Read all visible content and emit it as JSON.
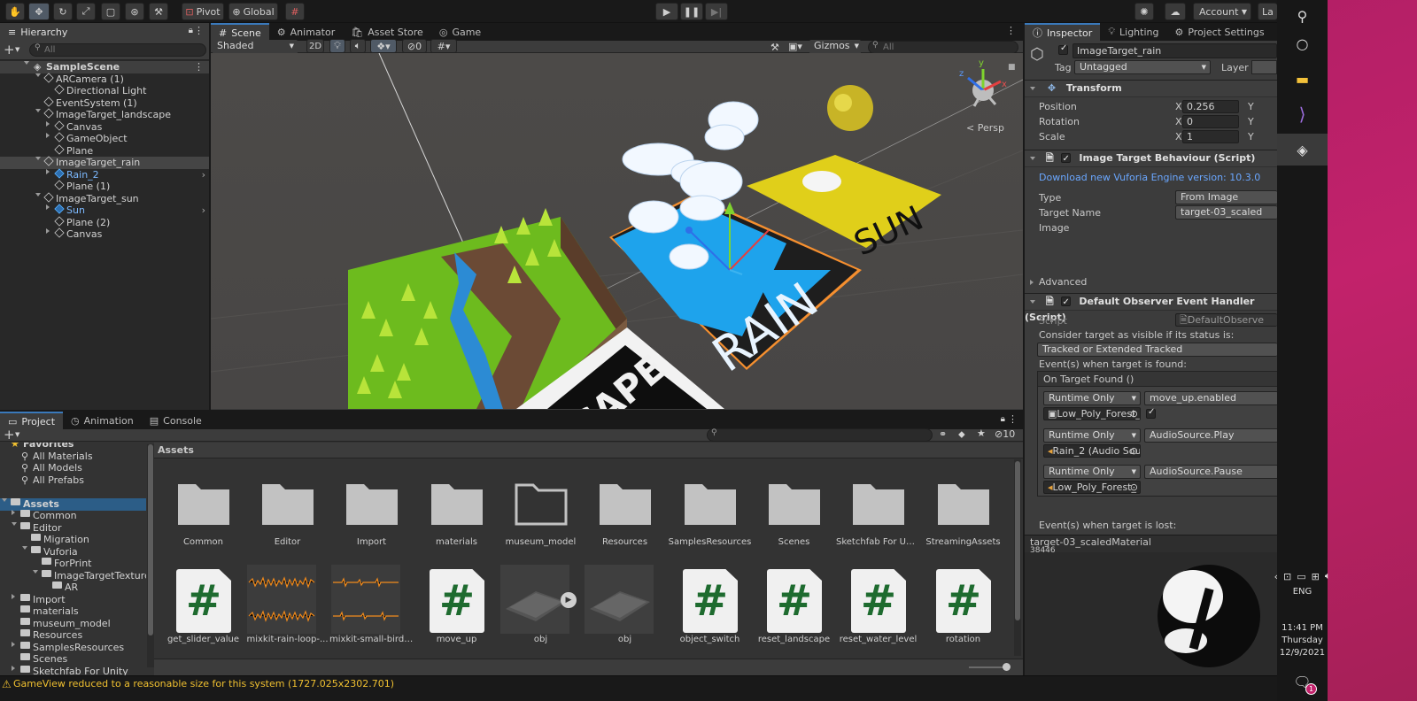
{
  "toolbar": {
    "pivot_label": "Pivot",
    "global_label": "Global",
    "account_label": "Account",
    "layers_label": "La"
  },
  "hierarchy": {
    "tab": "Hierarchy",
    "search_placeholder": "All",
    "items": [
      {
        "label": "SampleScene",
        "indent": 0
      },
      {
        "label": "ARCamera (1)",
        "indent": 1
      },
      {
        "label": "Directional Light",
        "indent": 2
      },
      {
        "label": "EventSystem (1)",
        "indent": 1
      },
      {
        "label": "ImageTarget_landscape",
        "indent": 1
      },
      {
        "label": "Canvas",
        "indent": 2
      },
      {
        "label": "GameObject",
        "indent": 2
      },
      {
        "label": "Plane",
        "indent": 2
      },
      {
        "label": "ImageTarget_rain",
        "indent": 1
      },
      {
        "label": "Rain_2",
        "indent": 2
      },
      {
        "label": "Plane (1)",
        "indent": 2
      },
      {
        "label": "ImageTarget_sun",
        "indent": 1
      },
      {
        "label": "Sun",
        "indent": 2
      },
      {
        "label": "Plane (2)",
        "indent": 2
      },
      {
        "label": "Canvas",
        "indent": 2
      }
    ]
  },
  "scene": {
    "tabs": [
      "Scene",
      "Animator",
      "Asset Store",
      "Game"
    ],
    "shading": "Shaded",
    "mode_2d": "2D",
    "hidden_count": "0",
    "gizmos": "Gizmos",
    "search_placeholder": "All",
    "persp_label": "< Persp",
    "card_rain": "RAIN",
    "card_sun": "SUN",
    "card_scape": "CAPE",
    "axis_y": "y",
    "axis_z": "z",
    "axis_x": "x"
  },
  "inspector": {
    "tabs": [
      "Inspector",
      "Lighting",
      "Project Settings"
    ],
    "object_name": "ImageTarget_rain",
    "tag_label": "Tag",
    "tag_value": "Untagged",
    "layer_label": "Layer",
    "transform": {
      "title": "Transform",
      "position_label": "Position",
      "position_x": "0.256",
      "rotation_label": "Rotation",
      "rotation_x": "0",
      "scale_label": "Scale",
      "scale_x": "1",
      "axis_x": "X",
      "axis_y": "Y"
    },
    "itb": {
      "title": "Image Target Behaviour (Script)",
      "link": "Download new Vuforia Engine version: 10.3.0",
      "type_label": "Type",
      "type_value": "From Image",
      "target_name_label": "Target Name",
      "target_name_value": "target-03_scaled",
      "image_label": "Image"
    },
    "advanced_label": "Advanced",
    "doeh": {
      "title": "Default Observer Event Handler (Script)",
      "script_label": "Script",
      "script_value": "DefaultObserve",
      "visible_label": "Consider target as visible if its status is:",
      "visible_value": "Tracked or Extended Tracked",
      "found_label": "Event(s) when target is found:",
      "on_target_found": "On Target Found ()",
      "events": [
        {
          "runtime": "Runtime Only",
          "func": "move_up.enabled",
          "obj": "Low_Poly_Forest_",
          "has_check": true
        },
        {
          "runtime": "Runtime Only",
          "func": "AudioSource.Play",
          "obj": "Rain_2 (Audio Sou",
          "has_check": false
        },
        {
          "runtime": "Runtime Only",
          "func": "AudioSource.Pause",
          "obj": "Low_Poly_Forest_",
          "has_check": false
        }
      ],
      "lost_label": "Event(s) when target is lost:"
    },
    "material_name": "target-03_scaledMaterial",
    "material_sub": "38446"
  },
  "project": {
    "tabs": [
      "Project",
      "Animation",
      "Console"
    ],
    "hidden_count": "10",
    "favorites_label": "Favorites",
    "favorites": [
      "All Materials",
      "All Models",
      "All Prefabs"
    ],
    "tree": [
      {
        "label": "Assets",
        "indent": 0,
        "bold": true
      },
      {
        "label": "Common",
        "indent": 1
      },
      {
        "label": "Editor",
        "indent": 1
      },
      {
        "label": "Migration",
        "indent": 2
      },
      {
        "label": "Vuforia",
        "indent": 2
      },
      {
        "label": "ForPrint",
        "indent": 3
      },
      {
        "label": "ImageTargetTextures",
        "indent": 3
      },
      {
        "label": "AR",
        "indent": 4
      },
      {
        "label": "Import",
        "indent": 1
      },
      {
        "label": "materials",
        "indent": 1
      },
      {
        "label": "museum_model",
        "indent": 1
      },
      {
        "label": "Resources",
        "indent": 1
      },
      {
        "label": "SamplesResources",
        "indent": 1
      },
      {
        "label": "Scenes",
        "indent": 1
      },
      {
        "label": "Sketchfab For Unity",
        "indent": 1
      }
    ],
    "breadcrumb": "Assets",
    "row1": [
      "Common",
      "Editor",
      "Import",
      "materials",
      "museum_model",
      "Resources",
      "SamplesResources",
      "Scenes",
      "Sketchfab For Uni...",
      "StreamingAssets"
    ],
    "row2": [
      "get_slider_value",
      "mixkit-rain-loop-...",
      "mixkit-small-birds...",
      "move_up",
      "obj",
      "obj",
      "object_switch",
      "reset_landscape",
      "reset_water_level",
      "rotation"
    ]
  },
  "status_bar": {
    "message": "GameView reduced to a reasonable size for this system (1727.025x2302.701)"
  },
  "taskbar": {
    "lang": "ENG",
    "time": "11:41 PM",
    "day": "Thursday",
    "date": "12/9/2021",
    "notif_count": "1"
  }
}
